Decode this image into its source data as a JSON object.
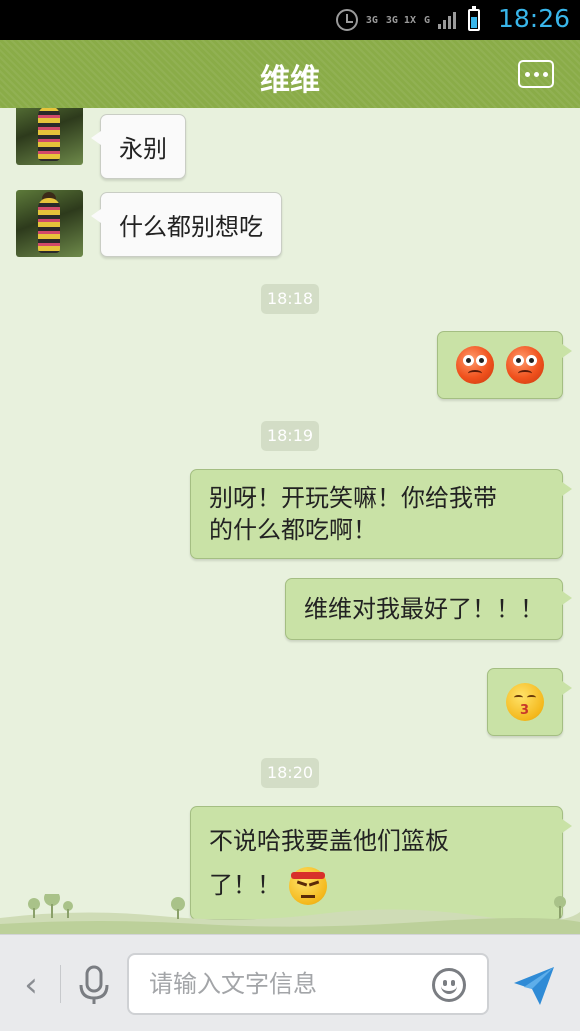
{
  "status_bar": {
    "net_type_1": "3G",
    "net_type_2": "3G 1X",
    "net_type_3": "G",
    "time": "18:26",
    "battery_level": 0.6,
    "icons": [
      "alarm-icon",
      "signal-icon",
      "battery-icon"
    ]
  },
  "header": {
    "title": "维维",
    "menu_icon": "more-icon"
  },
  "conversation": {
    "incoming": [
      {
        "text": "永别"
      },
      {
        "text": "什么都别想吃"
      }
    ],
    "timestamps": [
      "18:18",
      "18:19",
      "18:20"
    ],
    "outgoing": [
      {
        "emoji": [
          "angry-face-emoji",
          "angry-face-emoji"
        ]
      },
      {
        "line1": "别呀！开玩笑嘛！你给我带",
        "line2": "的什么都吃啊！"
      },
      {
        "text": "维维对我最好了！！！"
      },
      {
        "emoji": [
          "kiss-face-emoji"
        ]
      },
      {
        "line1": "不说哈我要盖他们篮板",
        "line2": "了！！",
        "emoji": "angry-headband-emoji"
      }
    ]
  },
  "input_bar": {
    "back_icon": "chevron-left-icon",
    "mic_icon": "microphone-icon",
    "placeholder": "请输入文字信息",
    "value": "",
    "emoji_icon": "smiley-icon",
    "send_icon": "send-icon"
  },
  "colors": {
    "header_green": "#8aac48",
    "chat_background": "#e8f1dd",
    "outgoing_bubble": "#c9e2a6",
    "incoming_bubble": "#fafafa",
    "status_accent": "#39b6ea"
  }
}
